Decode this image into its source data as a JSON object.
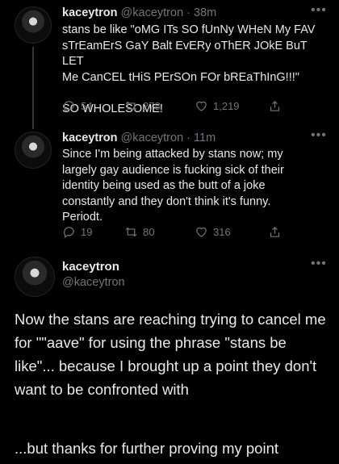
{
  "tweets": [
    {
      "name": "kaceytron",
      "handle": "@kaceytron",
      "time": "· 38m",
      "text": "stans be like \"oMG ITs SO fUnNy WHeN My FAV\nsTrEamErS GaY Balt EvERy oThER JOkE BuT LET\nMe CanCEL tHiS PErSOn FOr bREaThInG!!!\"\n\nSO WHOLESOME!",
      "replies": "54",
      "retweets": "278",
      "likes": "1,219"
    },
    {
      "name": "kaceytron",
      "handle": "@kaceytron",
      "time": "· 11m",
      "text": "Since I'm being attacked by stans now; my\nlargely gay audience is fucking sick of their\nidentity being used as the butt of a joke\nconstantly and they don't think it's funny.\nPeriodt.",
      "replies": "19",
      "retweets": "80",
      "likes": "316"
    }
  ],
  "main": {
    "name": "kaceytron",
    "handle": "@kaceytron",
    "paragraph1": "Now the stans are reaching trying to cancel me for \"\"aave\" for using the phrase \"stans be like\"... because I brought up a point they don't want to be confronted with",
    "paragraph2": "...but thanks for further proving my point"
  },
  "icons": [
    "more-icon",
    "reply-icon",
    "retweet-icon",
    "like-icon",
    "share-icon"
  ]
}
